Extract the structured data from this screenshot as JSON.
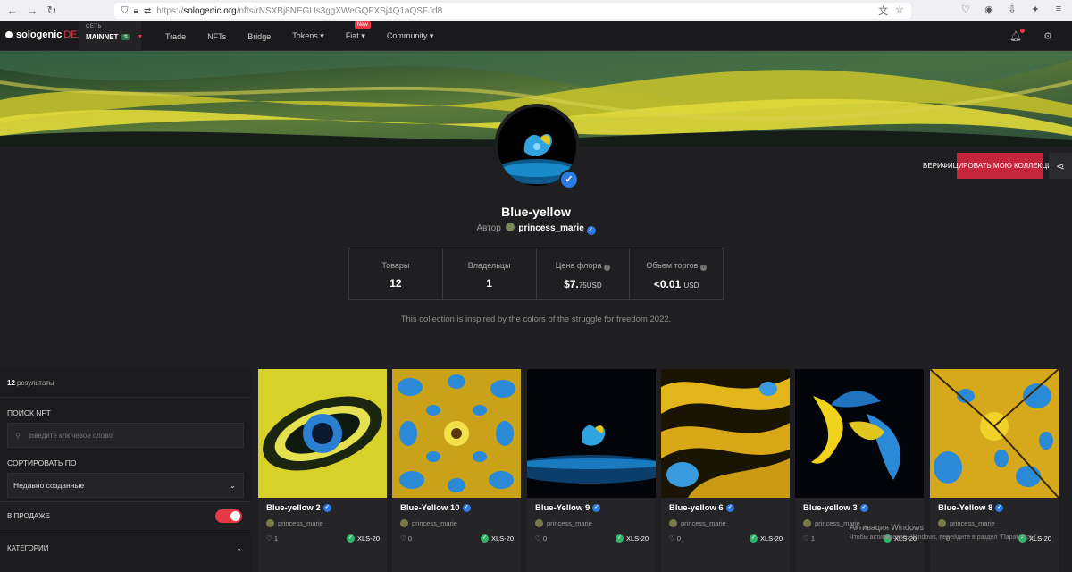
{
  "browser": {
    "url_prefix": "https://",
    "url_domain": "sologenic.org",
    "url_path": "/nfts/rNSXBj8NEGUs3ggXWeGQFXSj4Q1aQSFJd8"
  },
  "header": {
    "logo_text": "sologenic",
    "logo_suffix": "DEX",
    "network_label": "СЕТЬ",
    "network_value": "MAINNET",
    "menu": [
      "Trade",
      "NFTs",
      "Bridge",
      "Tokens",
      "Fiat",
      "Community"
    ],
    "fiat_badge": "New"
  },
  "collection": {
    "title": "Blue-yellow",
    "author_label": "Автор",
    "author_name": "princess_marie",
    "verify_button": "ВЕРИФИЦИРОВАТЬ МОЮ КОЛЛЕКЦИЮ",
    "description": "This collection is inspired by the colors of the struggle for freedom 2022.",
    "stats": [
      {
        "label": "Товары",
        "value": "12",
        "unit": ""
      },
      {
        "label": "Владельцы",
        "value": "1",
        "unit": ""
      },
      {
        "label": "Цена флора",
        "value": "$7.",
        "value2": "75",
        "unit": "USD"
      },
      {
        "label": "Объем торгов",
        "value": "<0.01",
        "value2": "",
        "unit": "USD"
      }
    ]
  },
  "sidebar": {
    "results_count": "12",
    "results_label": "результаты",
    "search_label": "ПОИСК NFT",
    "search_placeholder": "Введите ключевое слово",
    "sort_label": "СОРТИРОВАТЬ ПО",
    "sort_value": "Недавно созданные",
    "on_sale_label": "В ПРОДАЖЕ",
    "categories_label": "КАТЕГОРИИ"
  },
  "cards": [
    {
      "name": "Blue-yellow 2",
      "author": "princess_marie",
      "likes": "1",
      "standard": "XLS-20"
    },
    {
      "name": "Blue-Yellow 10",
      "author": "princess_marie",
      "likes": "0",
      "standard": "XLS-20"
    },
    {
      "name": "Blue-Yellow 9",
      "author": "princess_marie",
      "likes": "0",
      "standard": "XLS-20"
    },
    {
      "name": "Blue-yellow 6",
      "author": "princess_marie",
      "likes": "0",
      "standard": "XLS-20"
    },
    {
      "name": "Blue-yellow 3",
      "author": "princess_marie",
      "likes": "1",
      "standard": "XLS-20"
    },
    {
      "name": "Blue-Yellow 8",
      "author": "princess_marie",
      "likes": "0",
      "standard": "XLS-20"
    }
  ],
  "windows_activation": {
    "title": "Активация Windows",
    "subtitle": "Чтобы активировать Windows, перейдите в раздел \"Параметры\"."
  }
}
